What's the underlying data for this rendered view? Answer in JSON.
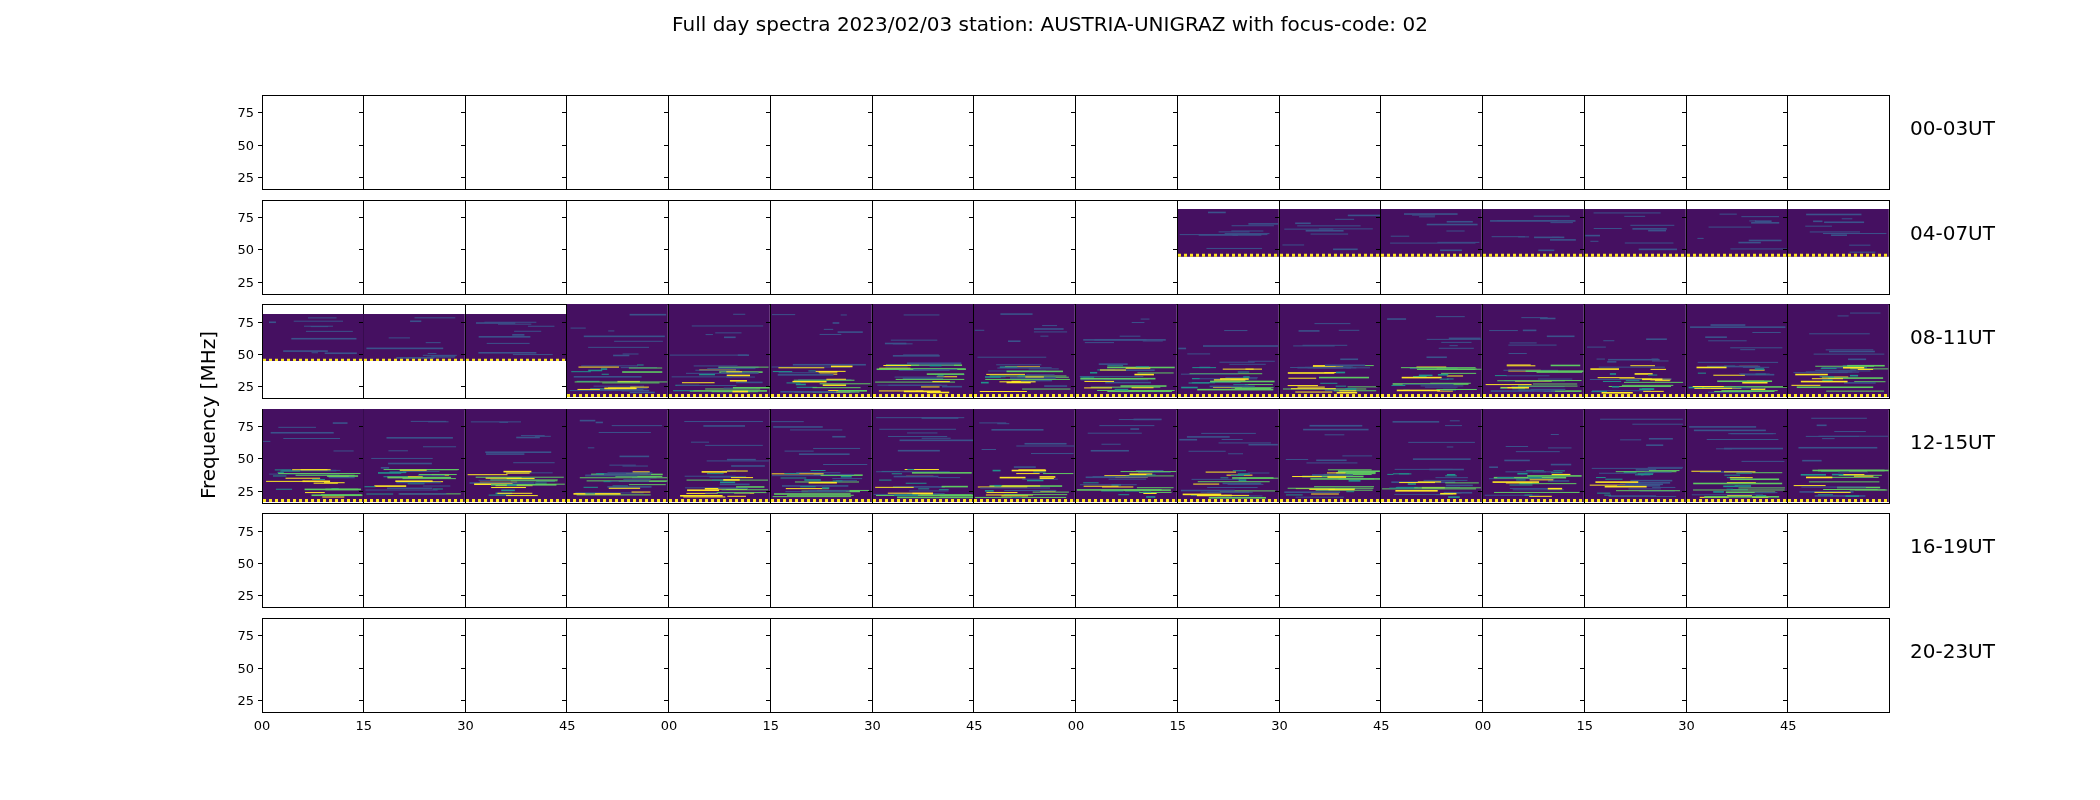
{
  "title": "Full day spectra 2023/02/03 station: AUSTRIA-UNIGRAZ with focus-code: 02",
  "ylabel": "Frequency [MHz]",
  "xticks": [
    "00",
    "15",
    "30",
    "45",
    "00",
    "15",
    "30",
    "45",
    "00",
    "15",
    "30",
    "45",
    "00",
    "15",
    "30",
    "45"
  ],
  "rows": [
    {
      "label": "00-03UT",
      "yticks": [
        "75",
        "50",
        "25"
      ],
      "panels": [
        {
          "kind": "empty"
        },
        {
          "kind": "empty"
        },
        {
          "kind": "empty"
        },
        {
          "kind": "empty"
        },
        {
          "kind": "empty"
        },
        {
          "kind": "empty"
        },
        {
          "kind": "empty"
        },
        {
          "kind": "empty"
        },
        {
          "kind": "empty"
        },
        {
          "kind": "empty"
        },
        {
          "kind": "empty"
        },
        {
          "kind": "empty"
        },
        {
          "kind": "empty"
        },
        {
          "kind": "empty"
        },
        {
          "kind": "empty"
        },
        {
          "kind": "empty"
        }
      ]
    },
    {
      "label": "04-07UT",
      "yticks": [
        "75",
        "50",
        "25"
      ],
      "panels": [
        {
          "kind": "empty"
        },
        {
          "kind": "empty"
        },
        {
          "kind": "empty"
        },
        {
          "kind": "empty"
        },
        {
          "kind": "empty"
        },
        {
          "kind": "empty"
        },
        {
          "kind": "empty"
        },
        {
          "kind": "empty"
        },
        {
          "kind": "empty"
        },
        {
          "kind": "upper"
        },
        {
          "kind": "upper"
        },
        {
          "kind": "upper"
        },
        {
          "kind": "upper"
        },
        {
          "kind": "upper"
        },
        {
          "kind": "upper"
        },
        {
          "kind": "upper"
        }
      ]
    },
    {
      "label": "08-11UT",
      "yticks": [
        "75",
        "50",
        "25"
      ],
      "panels": [
        {
          "kind": "upper"
        },
        {
          "kind": "upper"
        },
        {
          "kind": "upper"
        },
        {
          "kind": "full"
        },
        {
          "kind": "full"
        },
        {
          "kind": "full"
        },
        {
          "kind": "full"
        },
        {
          "kind": "full"
        },
        {
          "kind": "full"
        },
        {
          "kind": "full"
        },
        {
          "kind": "full"
        },
        {
          "kind": "full"
        },
        {
          "kind": "full"
        },
        {
          "kind": "full"
        },
        {
          "kind": "full"
        },
        {
          "kind": "full"
        }
      ]
    },
    {
      "label": "12-15UT",
      "yticks": [
        "75",
        "50",
        "25"
      ],
      "panels": [
        {
          "kind": "full"
        },
        {
          "kind": "full"
        },
        {
          "kind": "full"
        },
        {
          "kind": "full"
        },
        {
          "kind": "full"
        },
        {
          "kind": "full"
        },
        {
          "kind": "full"
        },
        {
          "kind": "full"
        },
        {
          "kind": "full"
        },
        {
          "kind": "full"
        },
        {
          "kind": "full"
        },
        {
          "kind": "full"
        },
        {
          "kind": "full"
        },
        {
          "kind": "full"
        },
        {
          "kind": "full"
        },
        {
          "kind": "full"
        }
      ]
    },
    {
      "label": "16-19UT",
      "yticks": [
        "75",
        "50",
        "25"
      ],
      "panels": [
        {
          "kind": "empty"
        },
        {
          "kind": "empty"
        },
        {
          "kind": "empty"
        },
        {
          "kind": "empty"
        },
        {
          "kind": "empty"
        },
        {
          "kind": "empty"
        },
        {
          "kind": "empty"
        },
        {
          "kind": "empty"
        },
        {
          "kind": "empty"
        },
        {
          "kind": "empty"
        },
        {
          "kind": "empty"
        },
        {
          "kind": "empty"
        },
        {
          "kind": "empty"
        },
        {
          "kind": "empty"
        },
        {
          "kind": "empty"
        },
        {
          "kind": "empty"
        }
      ]
    },
    {
      "label": "20-23UT",
      "yticks": [
        "75",
        "50",
        "25"
      ],
      "panels": [
        {
          "kind": "empty"
        },
        {
          "kind": "empty"
        },
        {
          "kind": "empty"
        },
        {
          "kind": "empty"
        },
        {
          "kind": "empty"
        },
        {
          "kind": "empty"
        },
        {
          "kind": "empty"
        },
        {
          "kind": "empty"
        },
        {
          "kind": "empty"
        },
        {
          "kind": "empty"
        },
        {
          "kind": "empty"
        },
        {
          "kind": "empty"
        },
        {
          "kind": "empty"
        },
        {
          "kind": "empty"
        },
        {
          "kind": "empty"
        },
        {
          "kind": "empty"
        }
      ]
    }
  ]
}
